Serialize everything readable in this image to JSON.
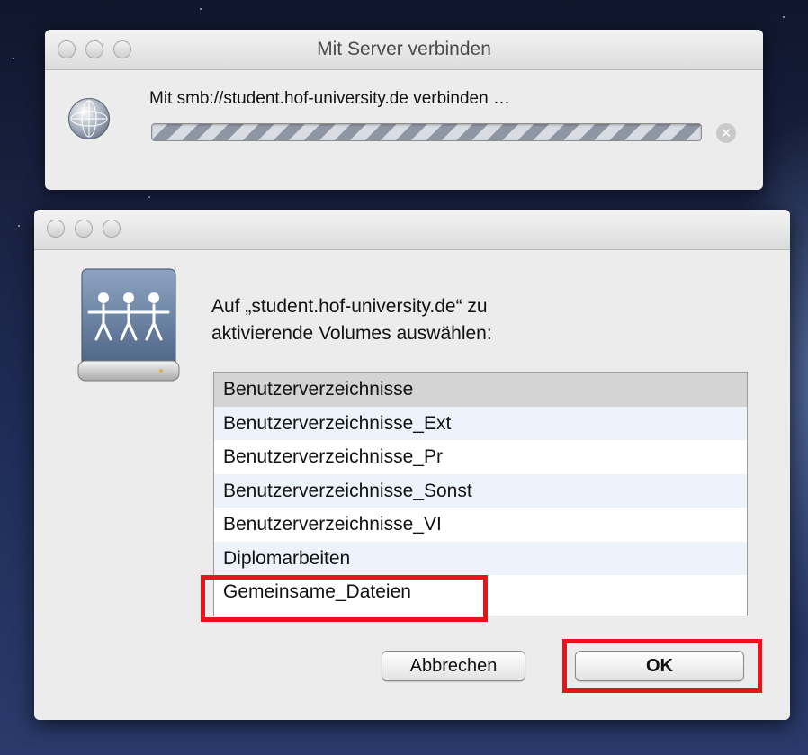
{
  "connect_window": {
    "title": "Mit Server verbinden",
    "status_text": "Mit smb://student.hof-university.de verbinden …",
    "icon": "globe-network-icon",
    "stop_icon": "stop-icon"
  },
  "volume_dialog": {
    "prompt_line1": "Auf „student.hof-university.de“ zu",
    "prompt_line2": "aktivierende Volumes auswählen:",
    "icon": "shared-drive-icon",
    "volumes": [
      {
        "label": "Benutzerverzeichnisse",
        "selected": true
      },
      {
        "label": "Benutzerverzeichnisse_Ext",
        "selected": false
      },
      {
        "label": "Benutzerverzeichnisse_Pr",
        "selected": false
      },
      {
        "label": "Benutzerverzeichnisse_Sonst",
        "selected": false
      },
      {
        "label": "Benutzerverzeichnisse_VI",
        "selected": false
      },
      {
        "label": "Diplomarbeiten",
        "selected": false
      },
      {
        "label": "Gemeinsame_Dateien",
        "selected": false
      }
    ],
    "cancel_label": "Abbrechen",
    "ok_label": "OK"
  },
  "colors": {
    "highlight": "#e8141c",
    "selected_row": "#d4d4d4",
    "alt_row": "#edf3fb"
  }
}
